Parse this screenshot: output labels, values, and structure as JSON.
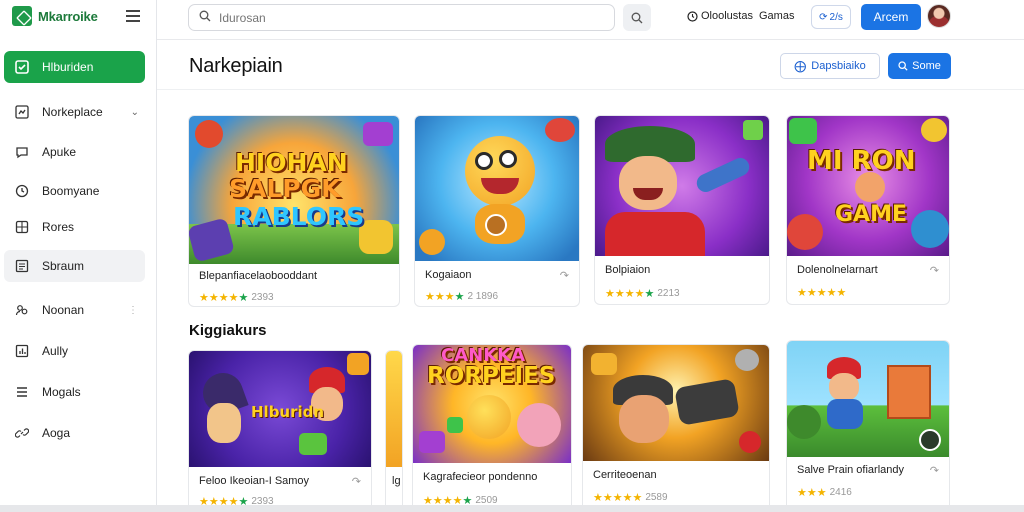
{
  "app": {
    "name": "Mkarroike"
  },
  "sidebar": {
    "items": [
      {
        "label": "Hlburiden",
        "icon": "check-square-icon"
      },
      {
        "label": "Norkeplace",
        "icon": "dashboard-icon"
      },
      {
        "label": "Apuke",
        "icon": "chat-icon"
      },
      {
        "label": "Boomyane",
        "icon": "clock-icon"
      },
      {
        "label": "Rores",
        "icon": "grid-icon"
      },
      {
        "label": "Sbraum",
        "icon": "list-icon"
      },
      {
        "label": "Noonan",
        "icon": "users-icon"
      },
      {
        "label": "Aully",
        "icon": "chart-icon"
      },
      {
        "label": "Mogals",
        "icon": "menu-icon"
      },
      {
        "label": "Aoga",
        "icon": "link-icon"
      }
    ]
  },
  "topbar": {
    "search_placeholder": "Idurosan",
    "link1": "Oloolustas",
    "link2": "Gamas",
    "pill": "2/s",
    "primary": "Arcem"
  },
  "header": {
    "title": "Narkepiain",
    "button1": "Dapsbiaiko",
    "button2": "Some"
  },
  "section2_title": "Kiggiakurs",
  "row1": [
    {
      "title": "Blepanfiacelaobooddant",
      "rating": "2393",
      "art_text": [
        "HIOHAN",
        "SALPGK",
        "RABLORS"
      ]
    },
    {
      "title": "Kogaiaon",
      "rating": "2 1896",
      "art_text": []
    },
    {
      "title": "Bolpiaion",
      "rating": "2213",
      "art_text": []
    },
    {
      "title": "Dolenolnelarnart",
      "rating": "",
      "art_text": [
        "MI RON",
        "GAME"
      ]
    }
  ],
  "row2": [
    {
      "title": "Feloo Ikeoian-I Samoy",
      "rating": "2393",
      "art_text": [
        "Hlburidn"
      ]
    },
    {
      "title": "Kagrafecieor pondenno",
      "rating": "2509",
      "art_text": [
        "CANKKA",
        "RORPEIES"
      ]
    },
    {
      "title": "Cerriteoenan",
      "rating": "2589",
      "art_text": []
    },
    {
      "title": "Salve Prain ofiarlandy",
      "rating": "2416",
      "art_text": []
    }
  ],
  "colors": {
    "accent": "#1aa34a",
    "primary": "#1b74e4",
    "star": "#f4b400"
  }
}
